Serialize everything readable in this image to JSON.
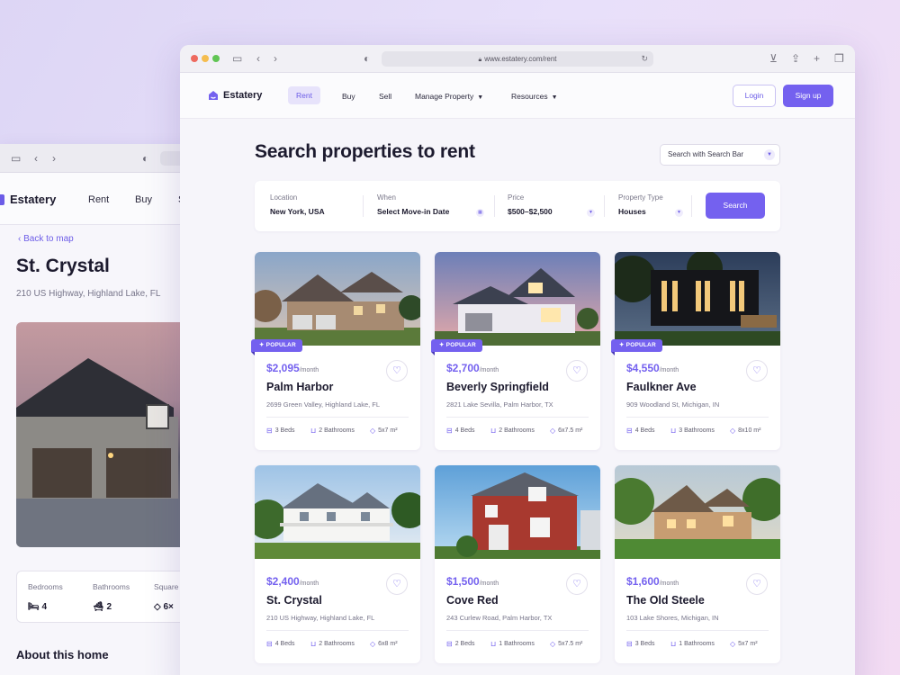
{
  "back": {
    "brand": "Estatery",
    "nav": [
      "Rent",
      "Buy",
      "S"
    ],
    "back_link": "Back to map",
    "title": "St. Crystal",
    "address": "210 US Highway, Highland Lake, FL",
    "stats": [
      {
        "label": "Bedrooms",
        "value": "4"
      },
      {
        "label": "Bathrooms",
        "value": "2"
      },
      {
        "label": "Square",
        "value": "6×"
      }
    ],
    "about": "About this home"
  },
  "browser": {
    "url": "www.estatery.com/rent"
  },
  "nav": {
    "brand": "Estatery",
    "items": [
      "Rent",
      "Buy",
      "Sell",
      "Manage Property",
      "Resources"
    ],
    "login": "Login",
    "signup": "Sign up"
  },
  "title": "Search properties to rent",
  "search_select": "Search with Search Bar",
  "filters": [
    {
      "label": "Location",
      "value": "New York, USA"
    },
    {
      "label": "When",
      "value": "Select Move-in Date"
    },
    {
      "label": "Price",
      "value": "$500–$2,500"
    },
    {
      "label": "Property Type",
      "value": "Houses"
    }
  ],
  "search_button": "Search",
  "listings": [
    {
      "badge": "POPULAR",
      "price": "$2,095",
      "per": "/month",
      "name": "Palm Harbor",
      "address": "2699 Green Valley, Highland Lake, FL",
      "beds": "3 Beds",
      "baths": "2 Bathrooms",
      "size": "5x7 m²"
    },
    {
      "badge": "POPULAR",
      "price": "$2,700",
      "per": "/month",
      "name": "Beverly Springfield",
      "address": "2821 Lake Sevilla, Palm Harbor, TX",
      "beds": "4 Beds",
      "baths": "2 Bathrooms",
      "size": "6x7.5 m²"
    },
    {
      "badge": "POPULAR",
      "price": "$4,550",
      "per": "/month",
      "name": "Faulkner Ave",
      "address": "909 Woodland St, Michigan, IN",
      "beds": "4 Beds",
      "baths": "3 Bathrooms",
      "size": "8x10 m²"
    },
    {
      "badge": "",
      "price": "$2,400",
      "per": "/month",
      "name": "St. Crystal",
      "address": "210 US Highway, Highland Lake, FL",
      "beds": "4 Beds",
      "baths": "2 Bathrooms",
      "size": "6x8 m²"
    },
    {
      "badge": "",
      "price": "$1,500",
      "per": "/month",
      "name": "Cove Red",
      "address": "243 Curlew Road, Palm Harbor, TX",
      "beds": "2 Beds",
      "baths": "1 Bathrooms",
      "size": "5x7.5 m²"
    },
    {
      "badge": "",
      "price": "$1,600",
      "per": "/month",
      "name": "The Old Steele",
      "address": "103 Lake Shores, Michigan, IN",
      "beds": "3 Beds",
      "baths": "1 Bathrooms",
      "size": "5x7 m²"
    }
  ],
  "colors": {
    "accent": "#7461ef",
    "accent_light": "#e7e3fb",
    "bg": "#f6f5fa"
  }
}
